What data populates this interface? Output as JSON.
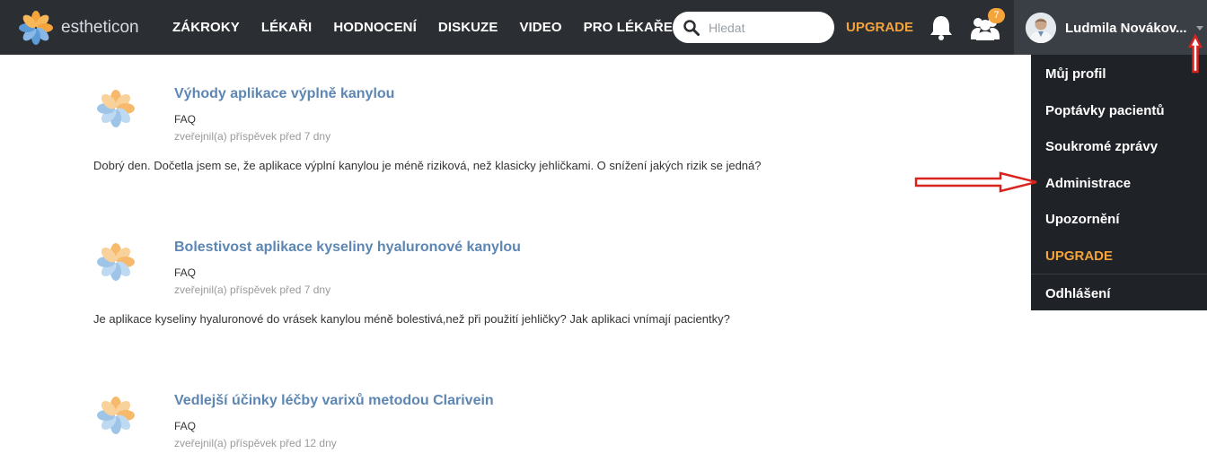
{
  "brand": {
    "name": "estheticon"
  },
  "nav": {
    "items": [
      "ZÁKROKY",
      "LÉKAŘI",
      "HODNOCENÍ",
      "DISKUZE",
      "VIDEO",
      "PRO LÉKAŘE"
    ]
  },
  "search": {
    "placeholder": "Hledat",
    "icon": "search-icon"
  },
  "header": {
    "upgrade_label": "UPGRADE",
    "notification_icon": "bell-icon",
    "friends_icon": "users-icon",
    "friends_badge": "7",
    "accent_color": "#f5a33b"
  },
  "user": {
    "name": "Ludmila Novákov..."
  },
  "user_menu": {
    "items": [
      {
        "label": "Můj profil"
      },
      {
        "label": "Poptávky pacientů"
      },
      {
        "label": "Soukromé zprávy"
      },
      {
        "label": "Administrace"
      },
      {
        "label": "Upozornění"
      },
      {
        "label": "UPGRADE"
      },
      {
        "label": "Odhlášení"
      }
    ]
  },
  "posts": [
    {
      "title": "Výhody aplikace výplně kanylou",
      "category": "FAQ",
      "meta": "zveřejnil(a) příspěvek před 7 dny",
      "body": "Dobrý den. Dočetla jsem se, že aplikace výplní kanylou je méně riziková, než klasicky jehličkami. O snížení jakých rizik se jedná?"
    },
    {
      "title": "Bolestivost aplikace kyseliny hyaluronové kanylou",
      "category": "FAQ",
      "meta": "zveřejnil(a) příspěvek před 7 dny",
      "body": "Je aplikace kyseliny hyaluronové do vrásek kanylou méně bolestivá,než při použití jehličky? Jak aplikaci vnímají pacientky?"
    },
    {
      "title": "Vedlejší účinky léčby varixů metodou Clarivein",
      "category": "FAQ",
      "meta": "zveřejnil(a) příspěvek před 12 dny"
    }
  ]
}
